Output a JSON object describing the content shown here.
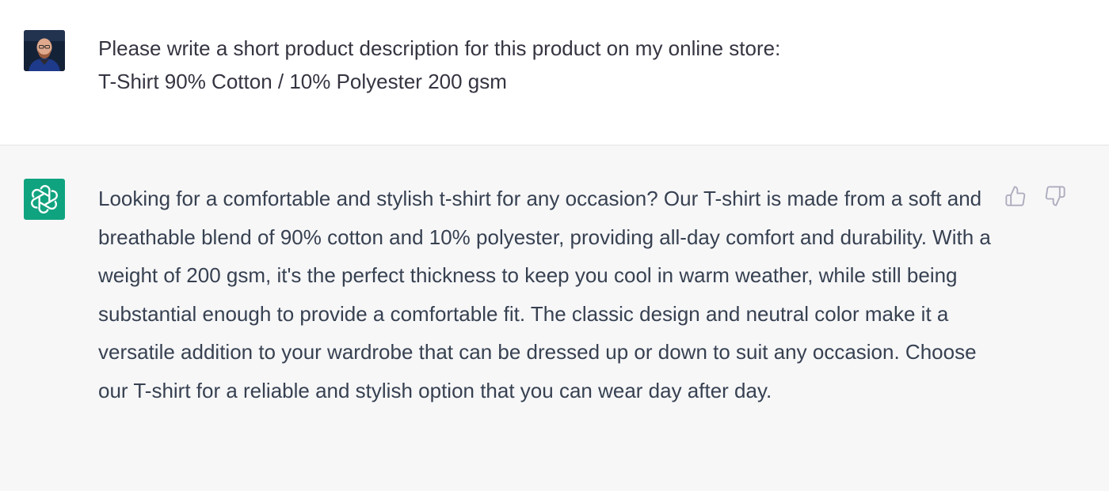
{
  "user_message": {
    "avatar_icon": "user-photo-avatar",
    "lines": [
      "Please write a short product description for this product on my online store:",
      "T-Shirt 90% Cotton / 10% Polyester 200 gsm"
    ]
  },
  "assistant_message": {
    "avatar_icon": "openai-logo-icon",
    "avatar_color": "#10a37f",
    "text": "Looking for a comfortable and stylish t-shirt for any occasion? Our T-shirt is made from a soft and breathable blend of 90% cotton and 10% polyester, providing all-day comfort and durability. With a weight of 200 gsm, it's the perfect thickness to keep you cool in warm weather, while still being substantial enough to provide a comfortable fit. The classic design and neutral color make it a versatile addition to your wardrobe that can be dressed up or down to suit any occasion. Choose our T-shirt for a reliable and stylish option that you can wear day after day.",
    "feedback": {
      "like_icon": "thumbs-up-icon",
      "dislike_icon": "thumbs-down-icon"
    }
  },
  "colors": {
    "user_background": "#ffffff",
    "assistant_background": "#f7f7f8",
    "text": "#374151",
    "divider": "#e5e5e6"
  }
}
